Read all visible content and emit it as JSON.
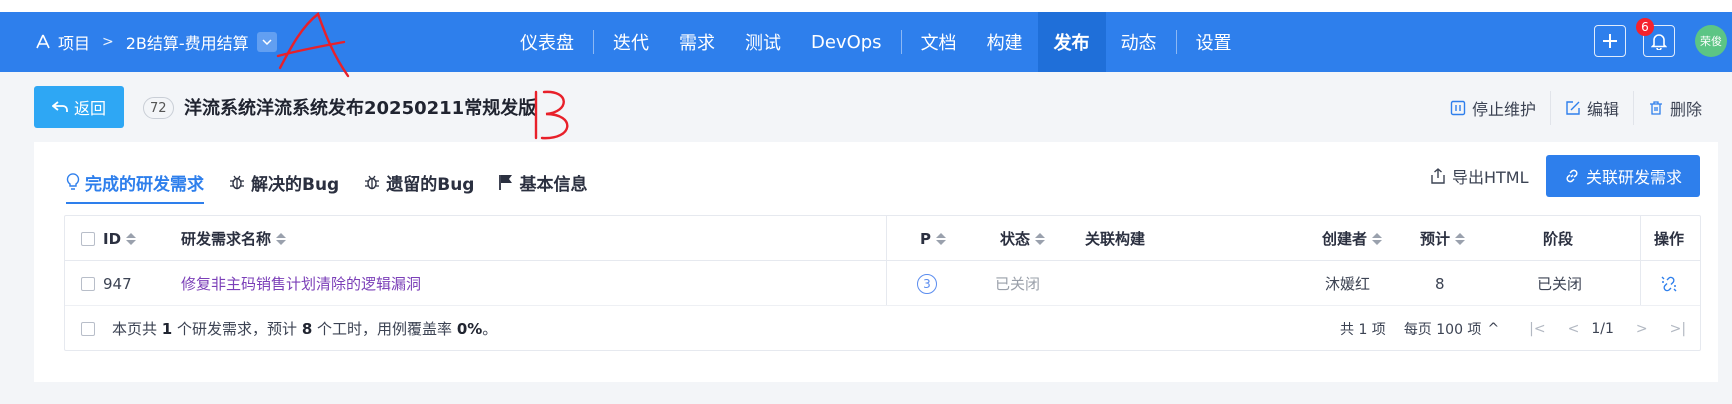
{
  "nav": {
    "breadcrumb_root": "项目",
    "project": "2B结算-费用结算",
    "items": [
      {
        "label": "仪表盘",
        "active": false
      },
      {
        "label": "迭代",
        "active": false
      },
      {
        "label": "需求",
        "active": false
      },
      {
        "label": "测试",
        "active": false
      },
      {
        "label": "DevOps",
        "active": false
      },
      {
        "label": "文档",
        "active": false
      },
      {
        "label": "构建",
        "active": false
      },
      {
        "label": "发布",
        "active": true
      },
      {
        "label": "动态",
        "active": false
      },
      {
        "label": "设置",
        "active": false
      }
    ],
    "notification_count": "6",
    "avatar_text": "荣俊"
  },
  "header": {
    "back_label": "返回",
    "id": "72",
    "title": "洋流系统洋流系统发布20250211常规发版",
    "actions": {
      "stop": "停止维护",
      "edit": "编辑",
      "delete": "删除"
    }
  },
  "tabs": [
    {
      "label": "完成的研发需求",
      "icon": "lightbulb-icon",
      "active": true
    },
    {
      "label": "解决的Bug",
      "icon": "bug-icon",
      "active": false
    },
    {
      "label": "遗留的Bug",
      "icon": "bug-icon",
      "active": false
    },
    {
      "label": "基本信息",
      "icon": "flag-icon",
      "active": false
    }
  ],
  "toolbar": {
    "export_label": "导出HTML",
    "link_label": "关联研发需求"
  },
  "table": {
    "columns": {
      "id": "ID",
      "name": "研发需求名称",
      "priority": "P",
      "status": "状态",
      "build": "关联构建",
      "creator": "创建者",
      "estimate": "预计",
      "stage": "阶段",
      "actions": "操作"
    },
    "rows": [
      {
        "id": "947",
        "name": "修复非主码销售计划清除的逻辑漏洞",
        "priority": "3",
        "status": "已关闭",
        "build": "",
        "creator": "沐媛红",
        "estimate": "8",
        "stage": "已关闭"
      }
    ],
    "footer": {
      "summary_prefix": "本页共",
      "count": "1",
      "summary_mid": "个研发需求，预计",
      "hours": "8",
      "summary_mid2": "个工时，用例覆盖率",
      "coverage": "0%",
      "summary_end": "。",
      "total": "共 1 项",
      "per_page": "每页 100 项",
      "page": "1/1"
    }
  }
}
